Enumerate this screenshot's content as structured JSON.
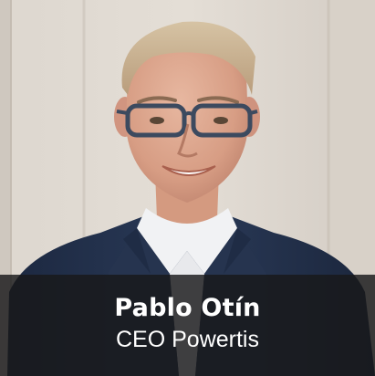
{
  "profile": {
    "name": "Pablo Otín",
    "role": "CEO Powertis"
  },
  "colors": {
    "caption_background": "#18181a",
    "caption_text": "#ffffff",
    "wall": "#d9d3cc",
    "jacket": "#23324c",
    "shirt": "#f1f2f4"
  }
}
